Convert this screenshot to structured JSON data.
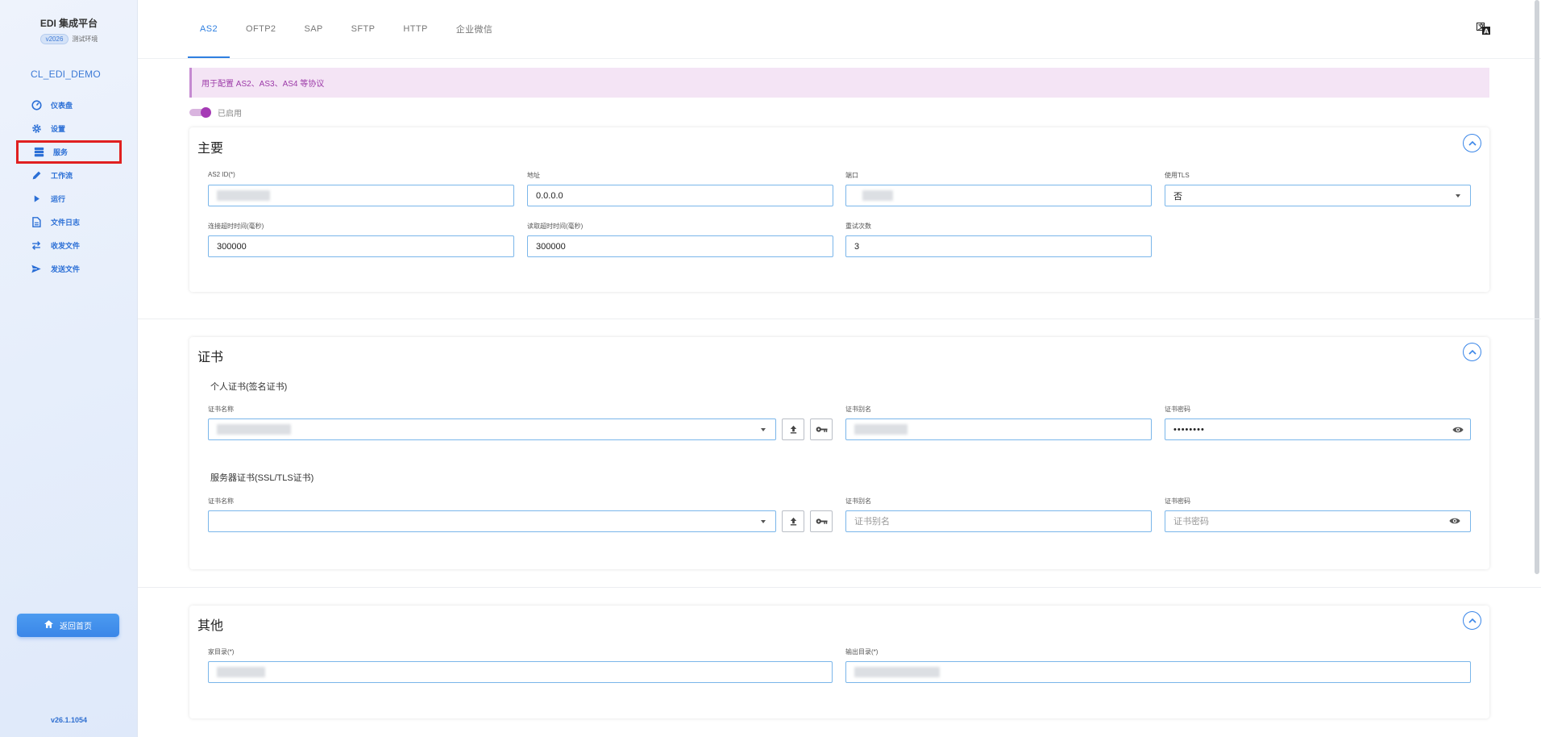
{
  "brand": {
    "title": "EDI 集成平台",
    "version_badge": "v2026",
    "env": "测试环境"
  },
  "tenant": "CL_EDI_DEMO",
  "nav": [
    {
      "label": "仪表盘",
      "icon": "dashboard-icon"
    },
    {
      "label": "设置",
      "icon": "gear-icon"
    },
    {
      "label": "服务",
      "icon": "server-icon"
    },
    {
      "label": "工作流",
      "icon": "pencil-icon"
    },
    {
      "label": "运行",
      "icon": "play-icon"
    },
    {
      "label": "文件日志",
      "icon": "document-icon"
    },
    {
      "label": "收发文件",
      "icon": "swap-icon"
    },
    {
      "label": "发送文件",
      "icon": "send-icon"
    }
  ],
  "active_nav": "服务",
  "home_button": "返回首页",
  "app_version": "v26.1.1054",
  "tabs": [
    "AS2",
    "OFTP2",
    "SAP",
    "SFTP",
    "HTTP",
    "企业微信"
  ],
  "active_tab": "AS2",
  "alert": "用于配置 AS2、AS3、AS4 等协议",
  "toggle": {
    "label": "已启用",
    "on": true
  },
  "main_section": {
    "title": "主要",
    "as2_id_label": "AS2 ID(*)",
    "address_label": "地址",
    "address_value": "0.0.0.0",
    "port_label": "端口",
    "tls_label": "使用TLS",
    "tls_value": "否",
    "connect_timeout_label": "连接超时时间(毫秒)",
    "connect_timeout_value": "300000",
    "read_timeout_label": "读取超时时间(毫秒)",
    "read_timeout_value": "300000",
    "retry_label": "重试次数",
    "retry_value": "3"
  },
  "cert_section": {
    "title": "证书",
    "personal_title": "个人证书(签名证书)",
    "cert_name_label": "证书名称",
    "cert_alias_label": "证书别名",
    "cert_password_label": "证书密码",
    "personal_password_value": "••••••••",
    "server_title": "服务器证书(SSL/TLS证书)",
    "alias_placeholder": "证书别名",
    "password_placeholder": "证书密码"
  },
  "other_section": {
    "title": "其他",
    "home_dir_label": "家目录(*)",
    "output_dir_label": "输出目录(*)"
  },
  "colors": {
    "primary": "#2f7fe0",
    "accent": "#a53ab5",
    "highlight": "#e02020"
  }
}
